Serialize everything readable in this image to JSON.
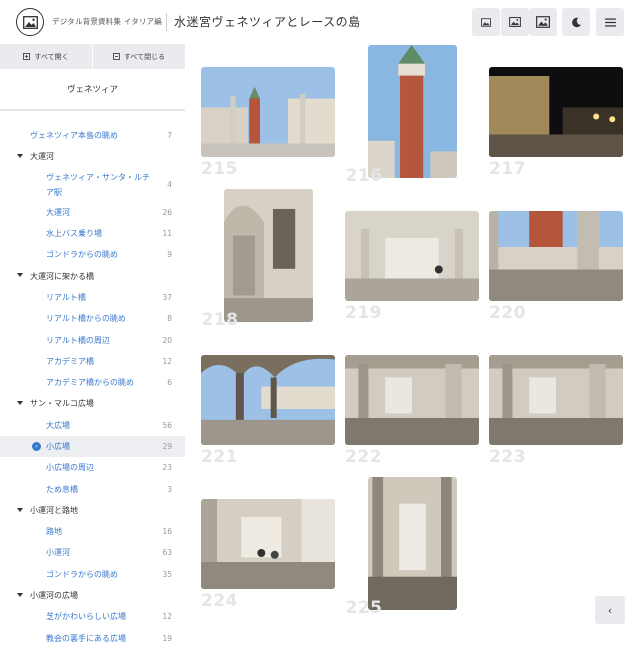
{
  "header": {
    "site_name": "デジタル背景資料集 イタリア編",
    "page_title": "水迷宮ヴェネツィアとレースの島",
    "view_buttons": [
      "small-thumbnails",
      "medium-thumbnails",
      "large-thumbnails"
    ],
    "dark_mode_icon": "moon-icon",
    "menu_icon": "hamburger-menu-icon"
  },
  "sidebar": {
    "expand_all": "すべて開く",
    "collapse_all": "すべて閉じる",
    "title": "ヴェネツィア",
    "items": [
      {
        "level": "top",
        "label": "ヴェネツィア本島の眺め",
        "count": "7"
      },
      {
        "level": "cat",
        "label": "大運河",
        "count": ""
      },
      {
        "level": "sub",
        "label": "ヴェネツィア・サンタ・ルチア駅",
        "count": "4",
        "two_line": true
      },
      {
        "level": "sub",
        "label": "大運河",
        "count": "26"
      },
      {
        "level": "sub",
        "label": "水上バス乗り場",
        "count": "11"
      },
      {
        "level": "sub",
        "label": "ゴンドラからの眺め",
        "count": "9"
      },
      {
        "level": "cat",
        "label": "大運河に架かる橋",
        "count": ""
      },
      {
        "level": "sub",
        "label": "リアルト橋",
        "count": "37"
      },
      {
        "level": "sub",
        "label": "リアルト橋からの眺め",
        "count": "8"
      },
      {
        "level": "sub",
        "label": "リアルト橋の周辺",
        "count": "20"
      },
      {
        "level": "sub",
        "label": "アカデミア橋",
        "count": "12"
      },
      {
        "level": "sub",
        "label": "アカデミア橋からの眺め",
        "count": "6"
      },
      {
        "level": "cat",
        "label": "サン・マルコ広場",
        "count": ""
      },
      {
        "level": "sub",
        "label": "大広場",
        "count": "56"
      },
      {
        "level": "sub",
        "label": "小広場",
        "count": "29",
        "active": true
      },
      {
        "level": "sub",
        "label": "小広場の周辺",
        "count": "23"
      },
      {
        "level": "sub",
        "label": "ため息橋",
        "count": "3"
      },
      {
        "level": "cat",
        "label": "小運河と路地",
        "count": ""
      },
      {
        "level": "sub",
        "label": "路地",
        "count": "16"
      },
      {
        "level": "sub",
        "label": "小運河",
        "count": "63"
      },
      {
        "level": "sub",
        "label": "ゴンドラからの眺め",
        "count": "35"
      },
      {
        "level": "cat",
        "label": "小運河の広場",
        "count": ""
      },
      {
        "level": "sub",
        "label": "芝がかわいらしい広場",
        "count": "12"
      },
      {
        "level": "sub",
        "label": "教会の裏手にある広場",
        "count": "19"
      }
    ]
  },
  "gallery": {
    "photos": [
      {
        "number": "215",
        "scene": "piazzetta-columns"
      },
      {
        "number": "216",
        "scene": "campanile-tower"
      },
      {
        "number": "217",
        "scene": "piazzetta-night"
      },
      {
        "number": "218",
        "scene": "arch-window"
      },
      {
        "number": "219",
        "scene": "arcade-people"
      },
      {
        "number": "220",
        "scene": "square-through-columns"
      },
      {
        "number": "221",
        "scene": "arcade-to-square"
      },
      {
        "number": "222",
        "scene": "arcade-corridor"
      },
      {
        "number": "223",
        "scene": "arcade-corridor-2"
      },
      {
        "number": "224",
        "scene": "arcade-walkers"
      },
      {
        "number": "225",
        "scene": "tall-arcade"
      }
    ]
  },
  "back_button_icon": "chevron-left-icon",
  "colors": {
    "link": "#3878cc",
    "button_bg": "#e9ebee",
    "number": "#e5e5e5"
  }
}
